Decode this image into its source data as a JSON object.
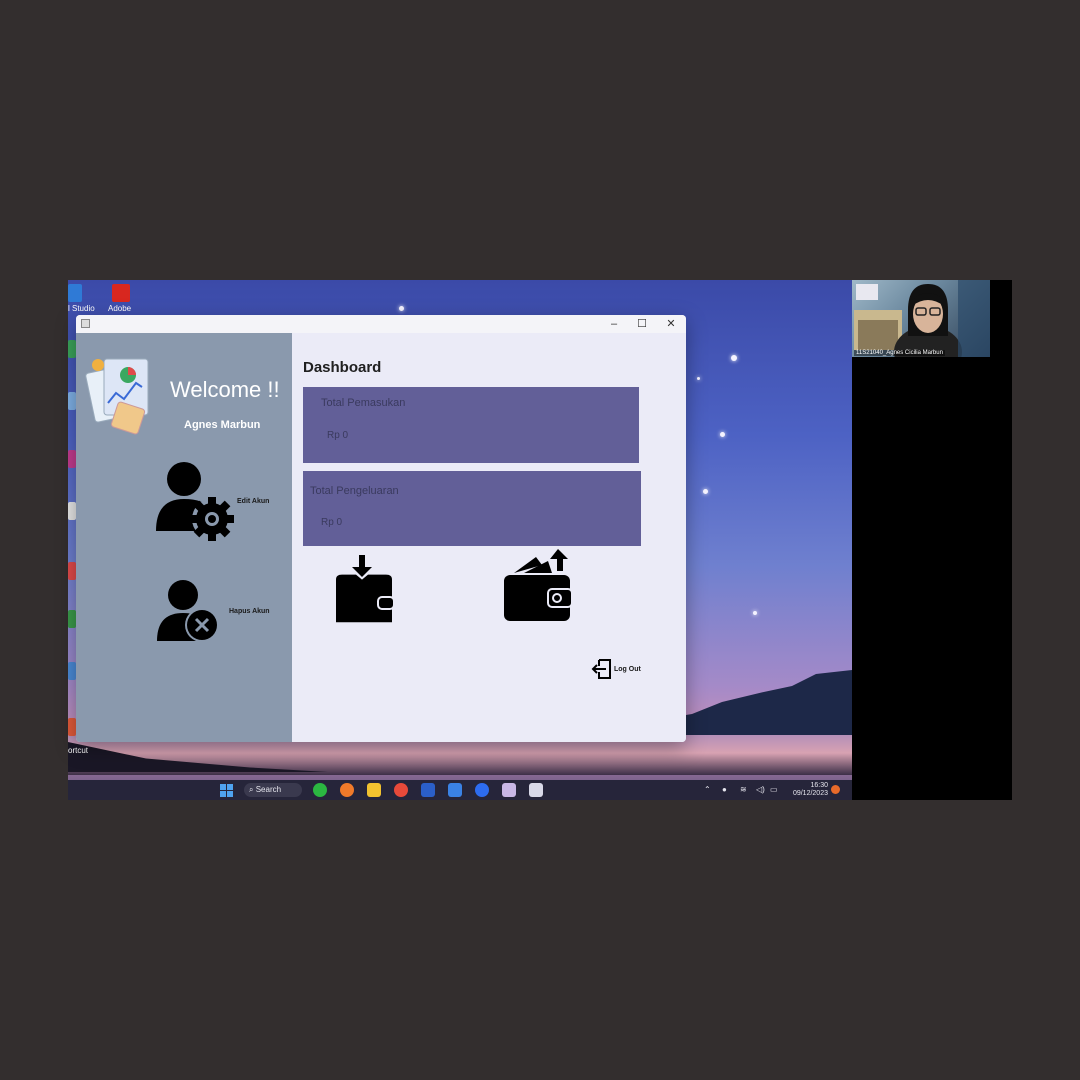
{
  "desktop": {
    "icons": [
      {
        "label": "l Studio",
        "color": "#2f7ad6"
      },
      {
        "label": "Adobe",
        "color": "#d8271f"
      }
    ],
    "shortcut_label": "ortcut"
  },
  "taskbar": {
    "search_label": "Search",
    "time": "16:30",
    "date": "09/12/2023"
  },
  "app": {
    "sidebar": {
      "welcome": "Welcome !!",
      "username": "Agnes Marbun",
      "edit_account_label": "Edit Akun",
      "delete_account_label": "Hapus Akun"
    },
    "main": {
      "title": "Dashboard",
      "cards": [
        {
          "label": "Total Pemasukan",
          "value": "Rp 0"
        },
        {
          "label": "Total Pengeluaran",
          "value": "Rp 0"
        }
      ],
      "logout_label": "Log Out"
    },
    "colors": {
      "sidebar": "#8a99ad",
      "card": "#625f98",
      "main": "#ebebf7"
    }
  },
  "video": {
    "participant_name": "11S21040_Agnes Cicilia Marbun"
  }
}
